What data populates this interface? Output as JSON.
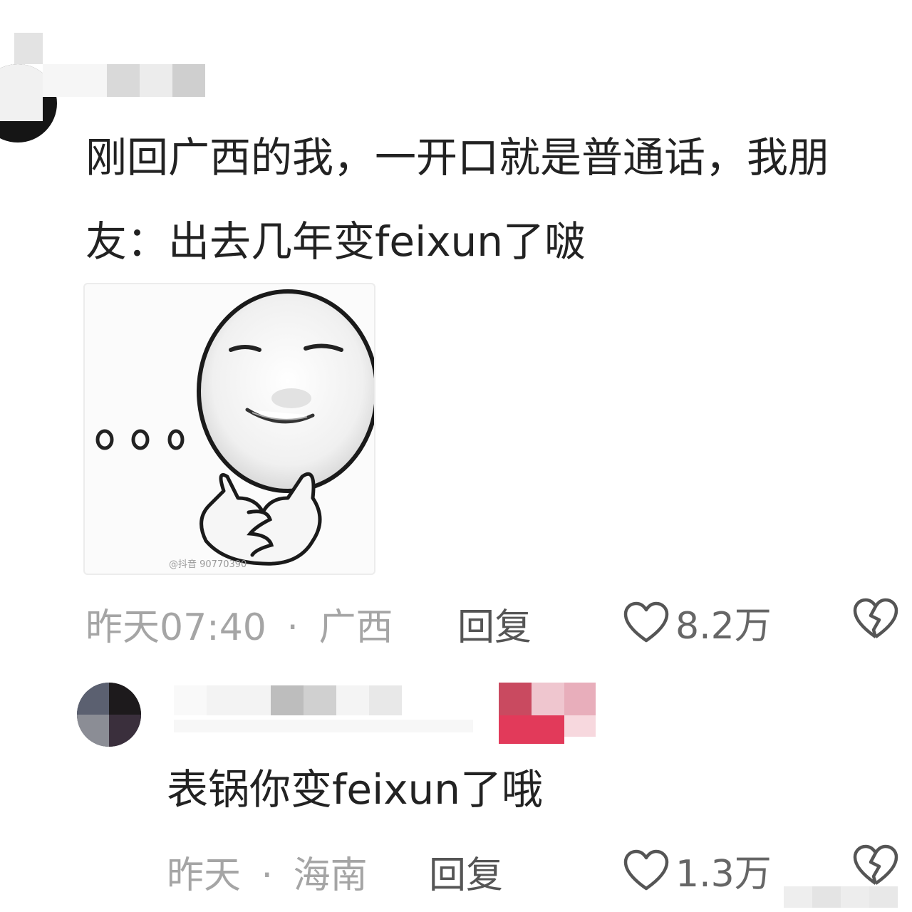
{
  "comment": {
    "text": "刚回广西的我，一开口就是普通话，我朋友：出去几年变feixun了啵",
    "time": "昨天07:40",
    "separator": "·",
    "location": "广西",
    "reply_label": "回复",
    "likes": "8.2万",
    "image": {
      "icon": "smiling-face-meme-icon",
      "watermark": "@抖音 90770390"
    }
  },
  "reply": {
    "text": "表锅你变feixun了哦",
    "time": "昨天",
    "separator": "·",
    "location": "海南",
    "reply_label": "回复",
    "likes": "1.3万"
  },
  "icons": {
    "like": "heart-outline-icon",
    "dislike": "broken-heart-icon"
  },
  "colors": {
    "text": "#222222",
    "meta": "#a5a5a5"
  }
}
